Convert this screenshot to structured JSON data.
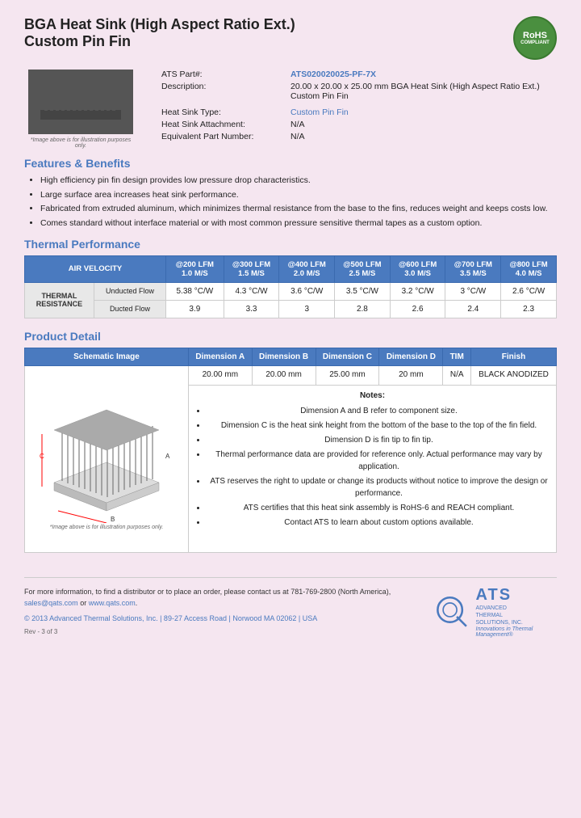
{
  "page": {
    "title_line1": "BGA Heat Sink (High Aspect Ratio Ext.)",
    "title_line2": "Custom Pin Fin"
  },
  "rohs": {
    "label": "RoHS",
    "sublabel": "COMPLIANT"
  },
  "part_info": {
    "part_number_label": "ATS Part#:",
    "part_number_value": "ATS020020025-PF-7X",
    "description_label": "Description:",
    "description_value": "20.00 x 20.00 x 25.00 mm BGA Heat Sink (High Aspect Ratio Ext.) Custom Pin Fin",
    "heat_sink_type_label": "Heat Sink Type:",
    "heat_sink_type_value": "Custom Pin Fin",
    "attachment_label": "Heat Sink Attachment:",
    "attachment_value": "N/A",
    "equivalent_label": "Equivalent Part Number:",
    "equivalent_value": "N/A"
  },
  "image_caption": "*Image above is for illustration purposes only.",
  "features": {
    "section_title": "Features & Benefits",
    "items": [
      "High efficiency pin fin design provides low pressure drop characteristics.",
      "Large surface area increases heat sink performance.",
      "Fabricated from extruded aluminum, which minimizes thermal resistance from the base to the fins, reduces weight and keeps costs low.",
      "Comes standard without interface material or with most common pressure sensitive thermal tapes as a custom option."
    ]
  },
  "thermal": {
    "section_title": "Thermal Performance",
    "header_row": {
      "air_velocity": "AIR VELOCITY",
      "col1": "@200 LFM\n1.0 M/S",
      "col2": "@300 LFM\n1.5 M/S",
      "col3": "@400 LFM\n2.0 M/S",
      "col4": "@500 LFM\n2.5 M/S",
      "col5": "@600 LFM\n3.0 M/S",
      "col6": "@700 LFM\n3.5 M/S",
      "col7": "@800 LFM\n4.0 M/S"
    },
    "section_label": "THERMAL RESISTANCE",
    "rows": [
      {
        "label": "Unducted Flow",
        "values": [
          "5.38 °C/W",
          "4.3 °C/W",
          "3.6 °C/W",
          "3.5 °C/W",
          "3.2 °C/W",
          "3 °C/W",
          "2.6 °C/W"
        ]
      },
      {
        "label": "Ducted Flow",
        "values": [
          "3.9",
          "3.3",
          "3",
          "2.8",
          "2.6",
          "2.4",
          "2.3"
        ]
      }
    ]
  },
  "product_detail": {
    "section_title": "Product Detail",
    "headers": [
      "Schematic Image",
      "Dimension A",
      "Dimension B",
      "Dimension C",
      "Dimension D",
      "TIM",
      "Finish"
    ],
    "values": {
      "dim_a": "20.00 mm",
      "dim_b": "20.00 mm",
      "dim_c": "25.00 mm",
      "dim_d": "20 mm",
      "tim": "N/A",
      "finish": "BLACK ANODIZED"
    },
    "notes_title": "Notes:",
    "notes": [
      "Dimension A and B refer to component size.",
      "Dimension C is the heat sink height from the bottom of the base to the top of the fin field.",
      "Dimension D is fin tip to fin tip.",
      "Thermal performance data are provided for reference only. Actual performance may vary by application.",
      "ATS reserves the right to update or change its products without notice to improve the design or performance.",
      "ATS certifies that this heat sink assembly is RoHS-6 and REACH compliant.",
      "Contact ATS to learn about custom options available."
    ],
    "schematic_caption": "*Image above is for illustration purposes only."
  },
  "footer": {
    "contact_text": "For more information, to find a distributor or to place an order, please contact us at",
    "phone": "781-769-2800 (North America),",
    "email": "sales@qats.com",
    "or": "or",
    "website": "www.qats.com",
    "copyright": "© 2013 Advanced Thermal Solutions, Inc.",
    "address": "| 89-27 Access Road | Norwood MA  02062 | USA",
    "rev": "Rev - 3 of 3"
  },
  "ats_logo": {
    "main": "ATS",
    "line1": "ADVANCED",
    "line2": "THERMAL",
    "line3": "SOLUTIONS, INC.",
    "tagline": "Innovations in Thermal Management®"
  }
}
